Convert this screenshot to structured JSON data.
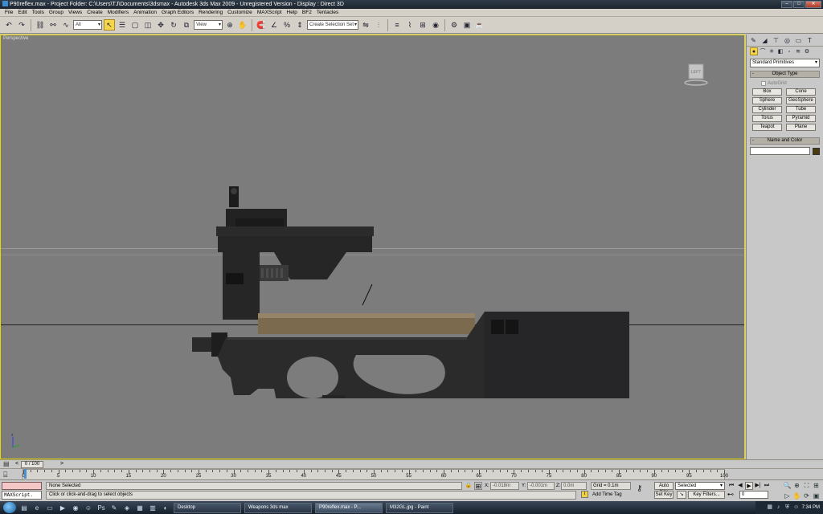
{
  "window": {
    "title": "P90reflex.max    - Project Folder: C:\\Users\\TJ\\Documents\\3dsmax     - Autodesk 3ds Max  2009   - Unregistered Version     - Display : Direct 3D",
    "controls": [
      "–",
      "□",
      "✕"
    ]
  },
  "menu": [
    "File",
    "Edit",
    "Tools",
    "Group",
    "Views",
    "Create",
    "Modifiers",
    "Animation",
    "Graph Editors",
    "Rendering",
    "Customize",
    "MAXScript",
    "Help",
    "BF2",
    "Tentacles"
  ],
  "toolbar": {
    "selection_filter": "All",
    "ref_coord": "View",
    "named_selection_placeholder": "Create Selection Set"
  },
  "viewport": {
    "label": "Perspective",
    "viewcube_face": "LEFT",
    "border_color": "#e7d800",
    "background": "#7c7c7c"
  },
  "command_panel": {
    "category": "Standard Primitives",
    "object_type_title": "Object Type",
    "autogrid": "AutoGrid",
    "buttons": [
      "Box",
      "Cone",
      "Sphere",
      "GeoSphere",
      "Cylinder",
      "Tube",
      "Torus",
      "Pyramid",
      "Teapot",
      "Plane"
    ],
    "name_color_title": "Name and Color",
    "swatch_color": "#4a3a10"
  },
  "time_slider": {
    "position": "0 / 100"
  },
  "trackbar": {
    "ticks": [
      "0",
      "5",
      "10",
      "15",
      "20",
      "25",
      "30",
      "35",
      "40",
      "45",
      "50",
      "55",
      "60",
      "65",
      "70",
      "75",
      "80",
      "85",
      "90",
      "95",
      "100"
    ]
  },
  "status": {
    "maxscript_label": "MAXScript.",
    "selection": "None Selected",
    "prompt": "Click or click-and-drag to select objects",
    "x_label": "X:",
    "x_value": "-0.018m",
    "y_label": "Y:",
    "y_value": "-0.001m",
    "z_label": "Z:",
    "z_value": "0.0m",
    "grid": "Grid = 0.1m",
    "add_time_tag": "Add Time Tag",
    "auto_key": "Auto Key",
    "set_key": "Set Key",
    "key_filter_value": "Selected",
    "key_filters": "Key Filters...",
    "frame": "0"
  },
  "taskbar": {
    "tasks": [
      "Desktop",
      "Weapons 3ds max",
      "P90reflex.max    - P...",
      "M32GL.jpg - Paint"
    ],
    "clock": "7:34 PM"
  }
}
